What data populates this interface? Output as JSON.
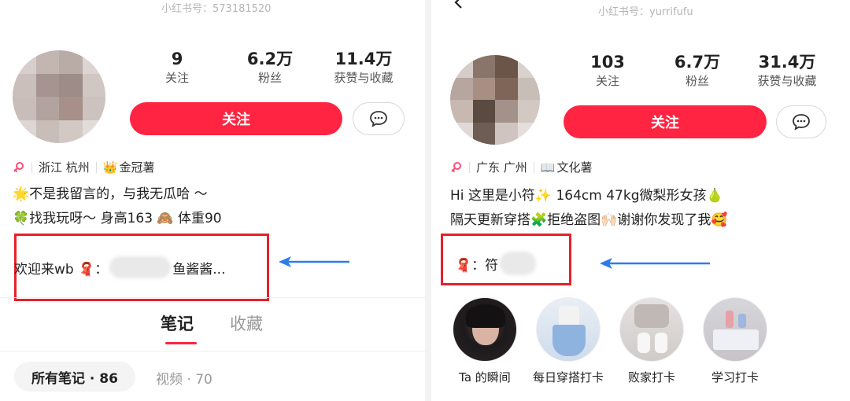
{
  "left": {
    "redbook_id": "小红书号：573181520",
    "stats": [
      {
        "num": "9",
        "label": "关注"
      },
      {
        "num": "6.2万",
        "label": "粉丝"
      },
      {
        "num": "11.4万",
        "label": "获赞与收藏"
      }
    ],
    "follow_label": "关注",
    "tags": {
      "location": "浙江  杭州",
      "badge": "金冠薯"
    },
    "bio": [
      "🌟不是我留言的，与我无瓜哈 ～",
      "🍀找我玩呀～ 身高163 🙈  体重90"
    ],
    "wb_prefix": "欢迎来wb 🧣：",
    "wb_suffix": "鱼酱酱...",
    "tabs": [
      "笔记",
      "收藏"
    ],
    "filter_active": "所有笔记 · 86",
    "filter_other": "视频 · 70"
  },
  "right": {
    "redbook_id": "小红书号：yurrifufu",
    "stats": [
      {
        "num": "103",
        "label": "关注"
      },
      {
        "num": "6.7万",
        "label": "粉丝"
      },
      {
        "num": "31.4万",
        "label": "获赞与收藏"
      }
    ],
    "follow_label": "关注",
    "tags": {
      "location": "广东  广州",
      "badge": "文化薯"
    },
    "bio": [
      "Hi 这里是小符✨ 164cm 47kg微梨形女孩🍐",
      "隔天更新穿搭🧩拒绝盗图🙌🏻谢谢你发现了我🥰"
    ],
    "wb_prefix": "🧣：符",
    "highlights": [
      {
        "label": "Ta 的瞬间"
      },
      {
        "label": "每日穿搭打卡"
      },
      {
        "label": "败家打卡"
      },
      {
        "label": "学习打卡"
      }
    ]
  },
  "colors": {
    "brand_red": "#ff2442",
    "annotation_red": "#e8202a",
    "arrow_blue": "#2b7de9"
  }
}
